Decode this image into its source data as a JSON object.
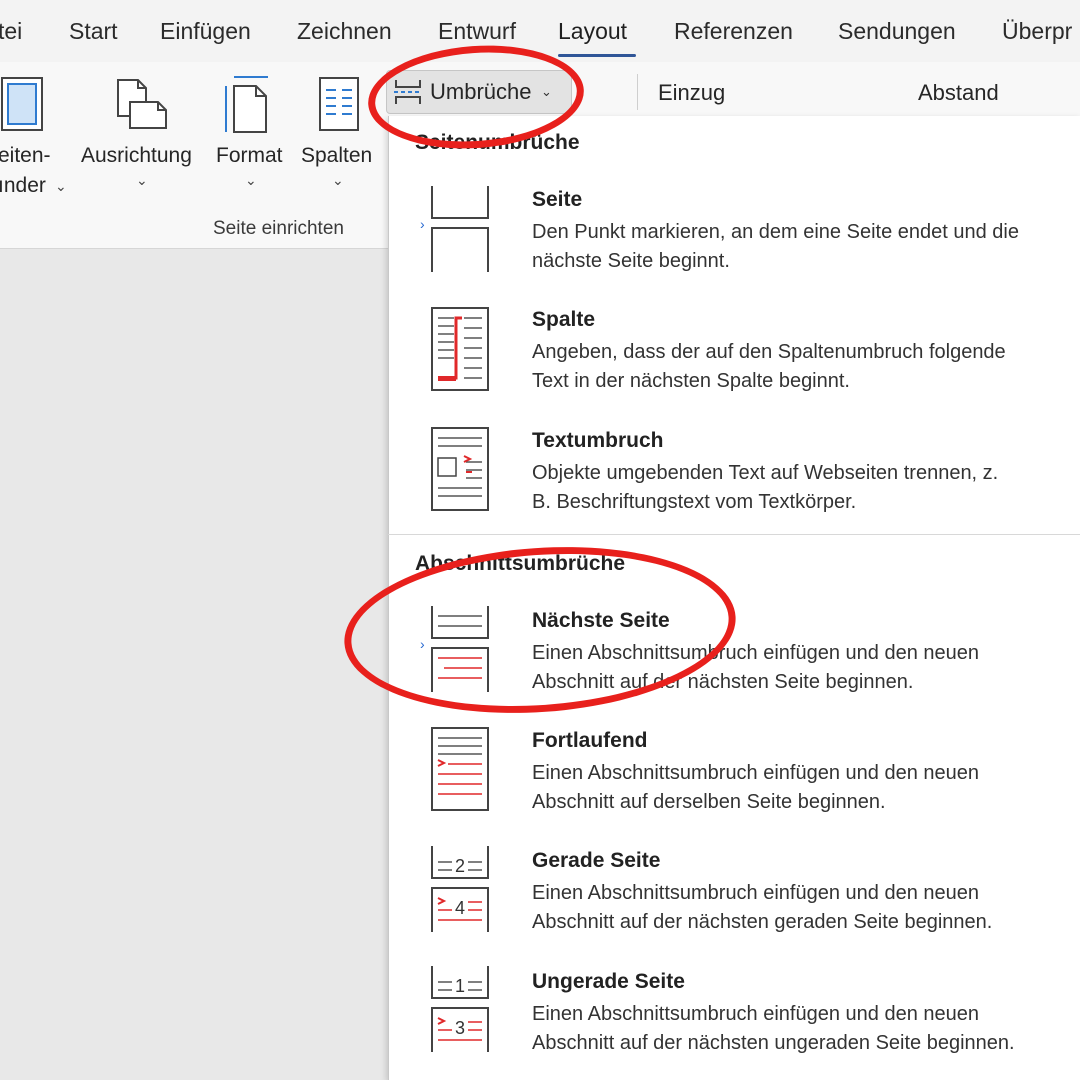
{
  "tabs": [
    {
      "label": "tei"
    },
    {
      "label": "Start"
    },
    {
      "label": "Einfügen"
    },
    {
      "label": "Zeichnen"
    },
    {
      "label": "Entwurf"
    },
    {
      "label": "Layout"
    },
    {
      "label": "Referenzen"
    },
    {
      "label": "Sendungen"
    },
    {
      "label": "Überpr"
    }
  ],
  "ribbon": {
    "margins_label_1": "eiten-",
    "margins_label_2": "ınder",
    "orientation_label": "Ausrichtung",
    "size_label": "Format",
    "columns_label": "Spalten",
    "group_label": "Seite einrichten",
    "breaks_label": "Umbrüche",
    "indent_label": "Einzug",
    "spacing_label": "Abstand"
  },
  "menu": {
    "page_breaks_header": "Seitenumbrüche",
    "section_breaks_header": "Abschnittsumbrüche",
    "items": [
      {
        "title": "Seite",
        "desc1": "Den Punkt markieren, an dem eine Seite endet und die",
        "desc2": "nächste Seite beginnt."
      },
      {
        "title": "Spalte",
        "desc1": "Angeben, dass der auf den Spaltenumbruch folgende",
        "desc2": "Text in der nächsten Spalte beginnt."
      },
      {
        "title": "Textumbruch",
        "desc1": "Objekte umgebenden Text auf Webseiten trennen, z.",
        "desc2": "B. Beschriftungstext vom Textkörper."
      },
      {
        "title": "Nächste Seite",
        "desc1": "Einen Abschnittsumbruch einfügen und den neuen",
        "desc2": "Abschnitt auf der nächsten Seite beginnen."
      },
      {
        "title": "Fortlaufend",
        "desc1": "Einen Abschnittsumbruch einfügen und den neuen",
        "desc2": "Abschnitt auf derselben Seite beginnen."
      },
      {
        "title": "Gerade Seite",
        "desc1": "Einen Abschnittsumbruch einfügen und den neuen",
        "desc2": "Abschnitt auf der nächsten geraden Seite beginnen."
      },
      {
        "title": "Ungerade Seite",
        "desc1": "Einen Abschnittsumbruch einfügen und den neuen",
        "desc2": "Abschnitt auf der nächsten ungeraden Seite beginnen."
      }
    ],
    "icon_numbers": {
      "even_top": "2",
      "even_bottom": "4",
      "odd_top": "1",
      "odd_bottom": "3"
    }
  },
  "colors": {
    "accent": "#2f5597",
    "annotation": "#e8201c",
    "icon_red": "#e0282a"
  }
}
